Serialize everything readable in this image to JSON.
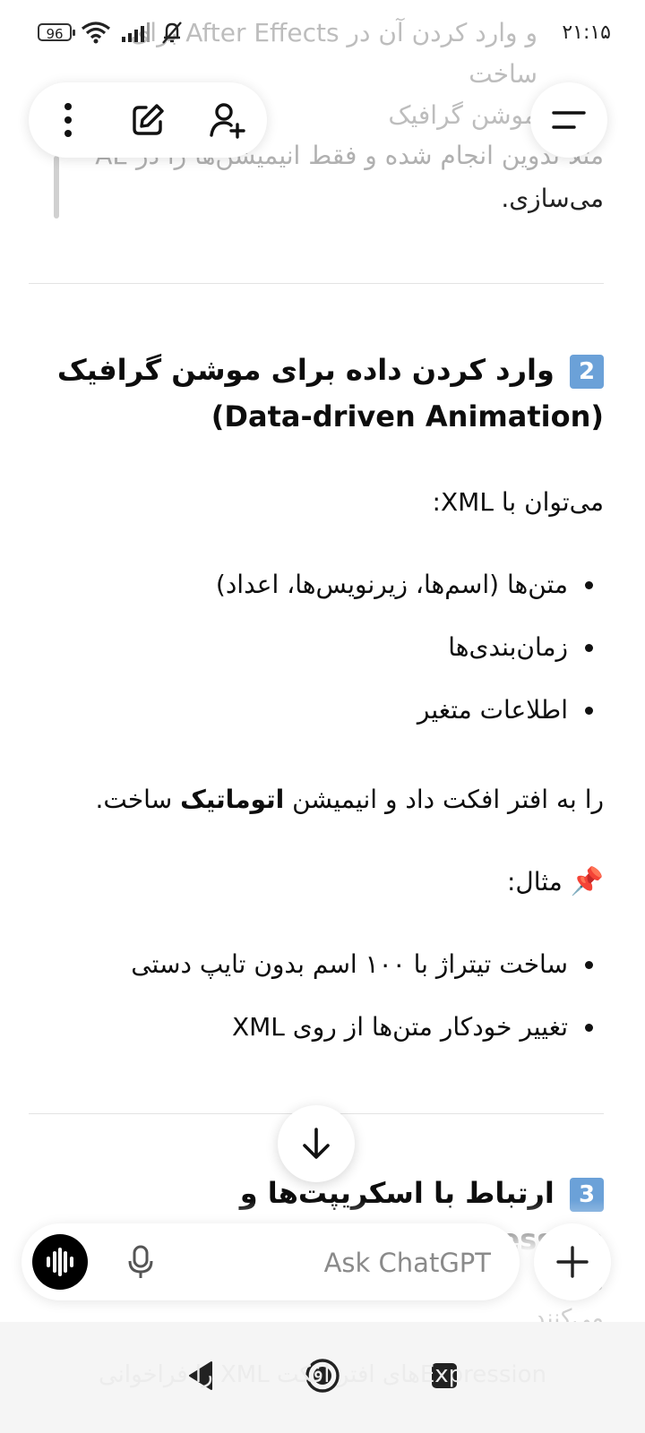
{
  "status_bar": {
    "time": "۲۱:۱۵",
    "battery": "96",
    "icons": [
      "battery-icon",
      "wifi-icon",
      "signal-icon",
      "mute-icon"
    ]
  },
  "faded_header": {
    "line1": "و وارد کردن آن در After Effects برای ساخت",
    "line2": "موشن گرافیک"
  },
  "toolbar": {
    "icons": [
      "more-vertical-icon",
      "edit-icon",
      "add-user-icon"
    ],
    "menu_icon": "menu-icon"
  },
  "quote": {
    "faded_text": "مثلاً تدوین انجام شده و فقط انیمیشن‌ها را در AE",
    "text": "می‌سازی."
  },
  "section2": {
    "badge": "2",
    "title_line1": "وارد کردن داده برای موشن گرافیک",
    "title_line2": "(Data-driven Animation)",
    "intro": "می‌توان با XML:",
    "items": [
      "متن‌ها (اسم‌ها، زیرنویس‌ها، اعداد)",
      "زمان‌بندی‌ها",
      "اطلاعات متغیر"
    ],
    "summary_pre": "را به افتر افکت داد و انیمیشن",
    "summary_bold": "اتوماتیک",
    "summary_post": "ساخت.",
    "example_icon": "📌",
    "example_label": "مثال:",
    "examples": [
      "ساخت تیتراژ با ۱۰۰ اسم بدون تایپ دستی",
      "تغییر خودکار متن‌ها از روی XML"
    ]
  },
  "section3": {
    "badge": "3",
    "title": "ارتباط با اسکریپت‌ها و Expressionها"
  },
  "composer": {
    "placeholder": "Ask ChatGPT",
    "value": ""
  },
  "faded_bottom": {
    "line1": "معی",
    "line2": "می‌کنند",
    "nav_line": "Expressionهای افتر افکت XML را فراخوانی"
  },
  "navbar": {
    "icons": [
      "back-icon",
      "home-icon",
      "recents-icon"
    ]
  },
  "colors": {
    "badge": "#6ba1d8",
    "accent_black": "#000000",
    "divider": "#e3e3e3"
  }
}
